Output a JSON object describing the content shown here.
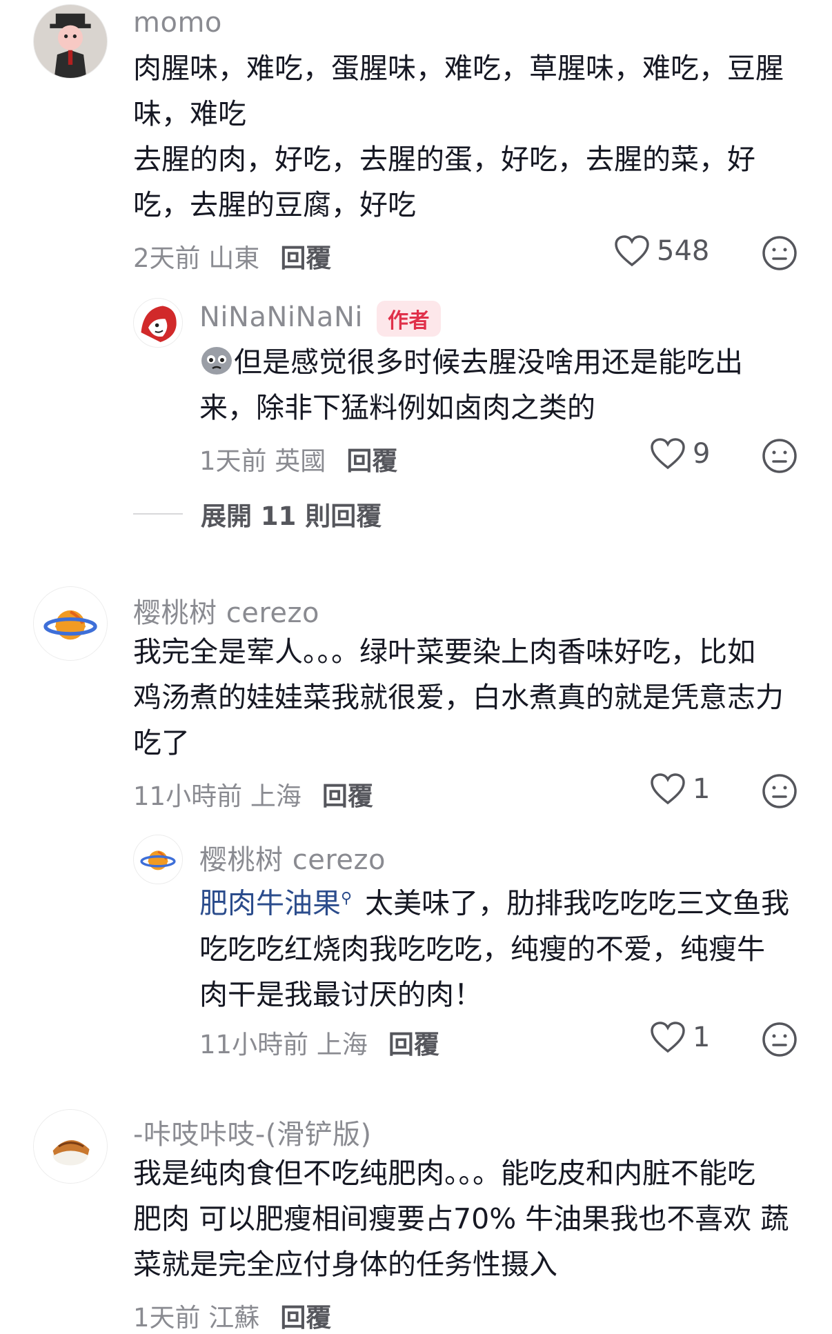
{
  "comments": [
    {
      "user": "momo",
      "lines": [
        "肉腥味，难吃，蛋腥味，难吃，草腥味，难吃，豆腥",
        "味，难吃",
        "去腥的肉，好吃，去腥的蛋，好吃，去腥的菜，好",
        "吃，去腥的豆腐，好吃"
      ],
      "time": "2天前 山東",
      "reply": "回覆",
      "likes": "548",
      "avatar_icon": "cartoon-man-avatar"
    },
    {
      "user": "NiNaNiNaNi",
      "badge": "作者",
      "lines": [
        "但是感觉很多时候去腥没啥用还是能吃出",
        "来，除非下猛料例如卤肉之类的"
      ],
      "emoji_icon": "crying-face-emoji",
      "time": "1天前 英國",
      "reply": "回覆",
      "likes": "9",
      "avatar_icon": "red-sketch-avatar"
    },
    {
      "expand": "展開 11 則回覆"
    },
    {
      "user": "樱桃树 cerezo",
      "lines": [
        "我完全是荤人。。。绿叶菜要染上肉香味好吃，比如",
        "鸡汤煮的娃娃菜我就很爱，白水煮真的就是凭意志力",
        "吃了"
      ],
      "time": "11小時前 上海",
      "reply": "回覆",
      "likes": "1",
      "avatar_icon": "planet-avatar"
    },
    {
      "user": "樱桃树 cerezo",
      "mention": "肥肉牛油果",
      "lines": [
        " 太美味了，肋排我吃吃吃三文鱼我",
        "吃吃吃红烧肉我吃吃吃，纯瘦的不爱，纯瘦牛",
        "肉干是我最讨厌的肉！"
      ],
      "time": "11小時前 上海",
      "reply": "回覆",
      "likes": "1",
      "avatar_icon": "planet-avatar"
    },
    {
      "user": "-咔吱咔吱-(滑铲版)",
      "lines": [
        "我是纯肉食但不吃纯肥肉。。。能吃皮和内脏不能吃",
        "肥肉 可以肥瘦相间瘦要占70% 牛油果我也不喜欢 蔬",
        "菜就是完全应付身体的任务性摄入"
      ],
      "time": "1天前 江蘇",
      "reply": "回覆",
      "avatar_icon": "sushi-avatar"
    }
  ],
  "colors": {
    "text": "#161823",
    "meta": "#8a8b91",
    "mention": "#2b4c8c",
    "badge": "#e0304a"
  },
  "icons": {
    "like": "heart-outline-icon",
    "dislike": "meh-face-icon",
    "search": "search-icon"
  }
}
